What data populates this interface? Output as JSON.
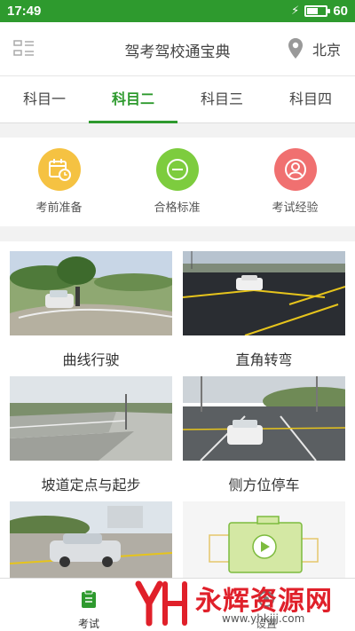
{
  "status_bar": {
    "time": "17:49",
    "battery_pct": "60",
    "battery_level": 0.6
  },
  "header": {
    "title": "驾考驾校通宝典",
    "city": "北京"
  },
  "tabs": [
    {
      "label": "科目一",
      "active": false
    },
    {
      "label": "科目二",
      "active": true
    },
    {
      "label": "科目三",
      "active": false
    },
    {
      "label": "科目四",
      "active": false
    }
  ],
  "quick_actions": [
    {
      "label": "考前准备",
      "icon": "calendar-clock-icon",
      "color": "#f5c242"
    },
    {
      "label": "合格标准",
      "icon": "minus-circle-icon",
      "color": "#7dcc3e"
    },
    {
      "label": "考试经验",
      "icon": "user-badge-icon",
      "color": "#f07070"
    }
  ],
  "items": [
    {
      "label": "曲线行驶"
    },
    {
      "label": "直角转弯"
    },
    {
      "label": "坡道定点与起步"
    },
    {
      "label": "侧方位停车"
    },
    {
      "label": ""
    },
    {
      "label": ""
    }
  ],
  "bottom_nav": [
    {
      "label": "考试",
      "icon": "clipboard-icon",
      "active": true
    },
    {
      "label": "设置",
      "icon": "settings-icon",
      "active": false
    }
  ],
  "watermark": {
    "brand": "永辉资源网",
    "url": "www.yhkjjj.com"
  },
  "colors": {
    "primary": "#2e9a2e",
    "background": "#f2f2f2"
  }
}
